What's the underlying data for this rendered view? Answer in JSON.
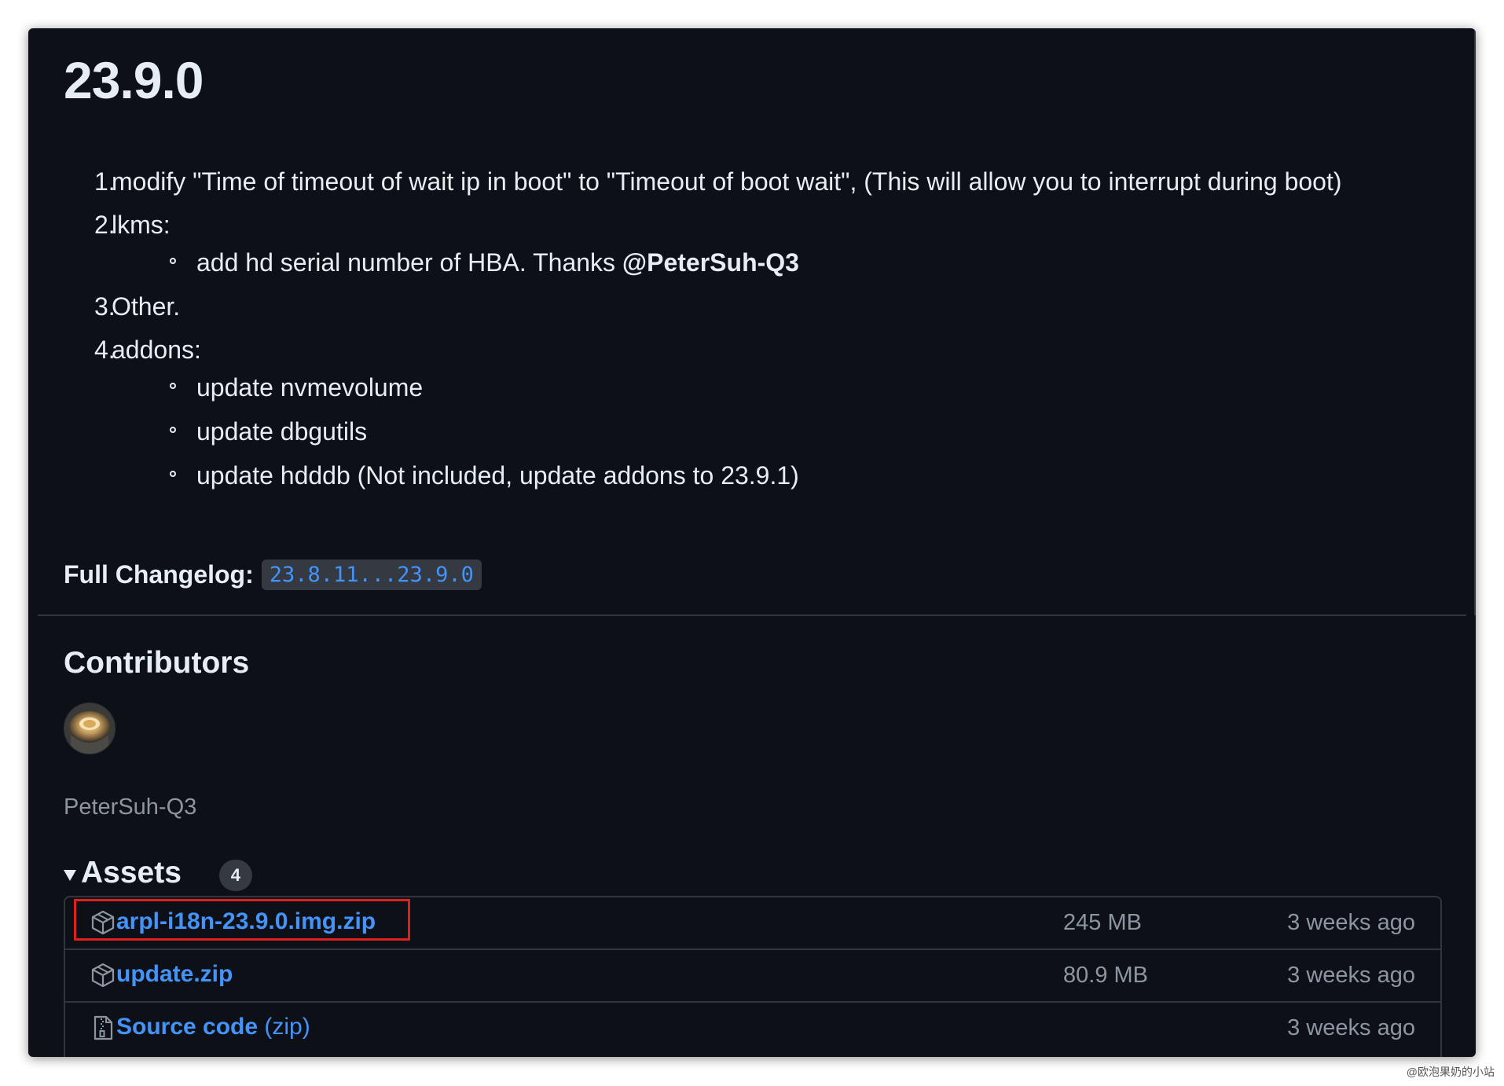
{
  "release": {
    "title": "23.9.0",
    "notes": [
      {
        "num": "1.",
        "text": "modify \"Time of timeout of wait ip in boot\" to \"Timeout of boot wait\", (This will allow you to interrupt during boot)",
        "sub": []
      },
      {
        "num": "2.",
        "text": "lkms:",
        "sub": [
          {
            "text": "add hd serial number of HBA. Thanks ",
            "mention": "@PeterSuh-Q3"
          }
        ]
      },
      {
        "num": "3.",
        "text": "Other.",
        "sub": []
      },
      {
        "num": "4.",
        "text": "addons:",
        "sub": [
          {
            "text": "update nvmevolume"
          },
          {
            "text": "update dbgutils"
          },
          {
            "text": "update hdddb (Not included, update addons to 23.9.1)"
          }
        ]
      }
    ],
    "changelog_label": "Full Changelog:",
    "changelog_range": "23.8.11...23.9.0"
  },
  "contributors": {
    "title": "Contributors",
    "names": [
      "PeterSuh-Q3"
    ]
  },
  "assets": {
    "title": "Assets",
    "count": "4",
    "items": [
      {
        "name": "arpl-i18n-23.9.0.img.zip",
        "suffix": "",
        "size": "245 MB",
        "date": "3 weeks ago",
        "icon": "package-icon"
      },
      {
        "name": "update.zip",
        "suffix": "",
        "size": "80.9 MB",
        "date": "3 weeks ago",
        "icon": "package-icon"
      },
      {
        "name": "Source code",
        "suffix": " (zip)",
        "size": "",
        "date": "3 weeks ago",
        "icon": "file-zip-icon"
      }
    ]
  },
  "colors": {
    "background": "#0d1117",
    "text": "#e6edf3",
    "muted": "#8d96a0",
    "link": "#4493f8",
    "border": "#30363d",
    "annotation": "#e0201b"
  },
  "watermark": "@欧泡果奶的小站"
}
